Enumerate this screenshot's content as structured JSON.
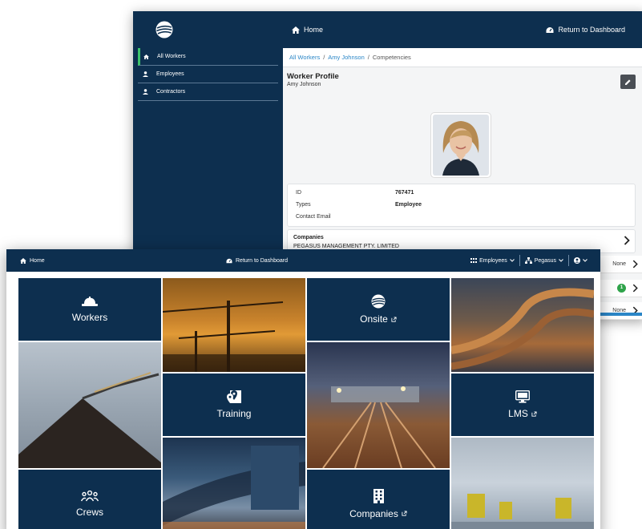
{
  "back_window": {
    "topbar": {
      "home_label": "Home",
      "return_label": "Return to Dashboard"
    },
    "sidebar": {
      "items": [
        {
          "label": "All Workers",
          "icon": "home-icon",
          "active": true
        },
        {
          "label": "Employees",
          "icon": "user-icon",
          "active": false
        },
        {
          "label": "Contractors",
          "icon": "user-icon",
          "active": false
        }
      ]
    },
    "breadcrumb": {
      "items": [
        "All Workers",
        "Amy Johnson",
        "Competencies"
      ],
      "separator": "/"
    },
    "profile": {
      "title": "Worker Profile",
      "name": "Amy Johnson",
      "details": [
        {
          "key": "ID",
          "value": "767471"
        },
        {
          "key": "Types",
          "value": "Employee"
        },
        {
          "key": "Contact Email",
          "value": ""
        }
      ],
      "companies_label": "Companies",
      "companies_value": "PEGASUS MANAGEMENT PTY. LIMITED"
    },
    "extra_rows": [
      {
        "text": "None",
        "badge": ""
      },
      {
        "text": "",
        "badge": "1"
      },
      {
        "text": "None",
        "badge": ""
      }
    ]
  },
  "front_window": {
    "topbar": {
      "home_label": "Home",
      "return_label": "Return to Dashboard",
      "employees_menu": "Employees",
      "org_menu": "Pegasus"
    },
    "tiles": [
      {
        "label": "Workers",
        "icon": "hard-hat-icon",
        "external": false
      },
      {
        "label": "Onsite",
        "icon": "globe-icon",
        "external": true
      },
      {
        "label": "Training",
        "icon": "map-pin-icon",
        "external": false
      },
      {
        "label": "LMS",
        "icon": "monitor-icon",
        "external": true
      },
      {
        "label": "Crews",
        "icon": "group-icon",
        "external": false
      },
      {
        "label": "Companies",
        "icon": "building-icon",
        "external": true
      }
    ]
  },
  "colors": {
    "navy": "#0d2f4f",
    "link_blue": "#2a86c7",
    "active_green": "#3cc36b",
    "badge_green": "#2fa34a"
  }
}
